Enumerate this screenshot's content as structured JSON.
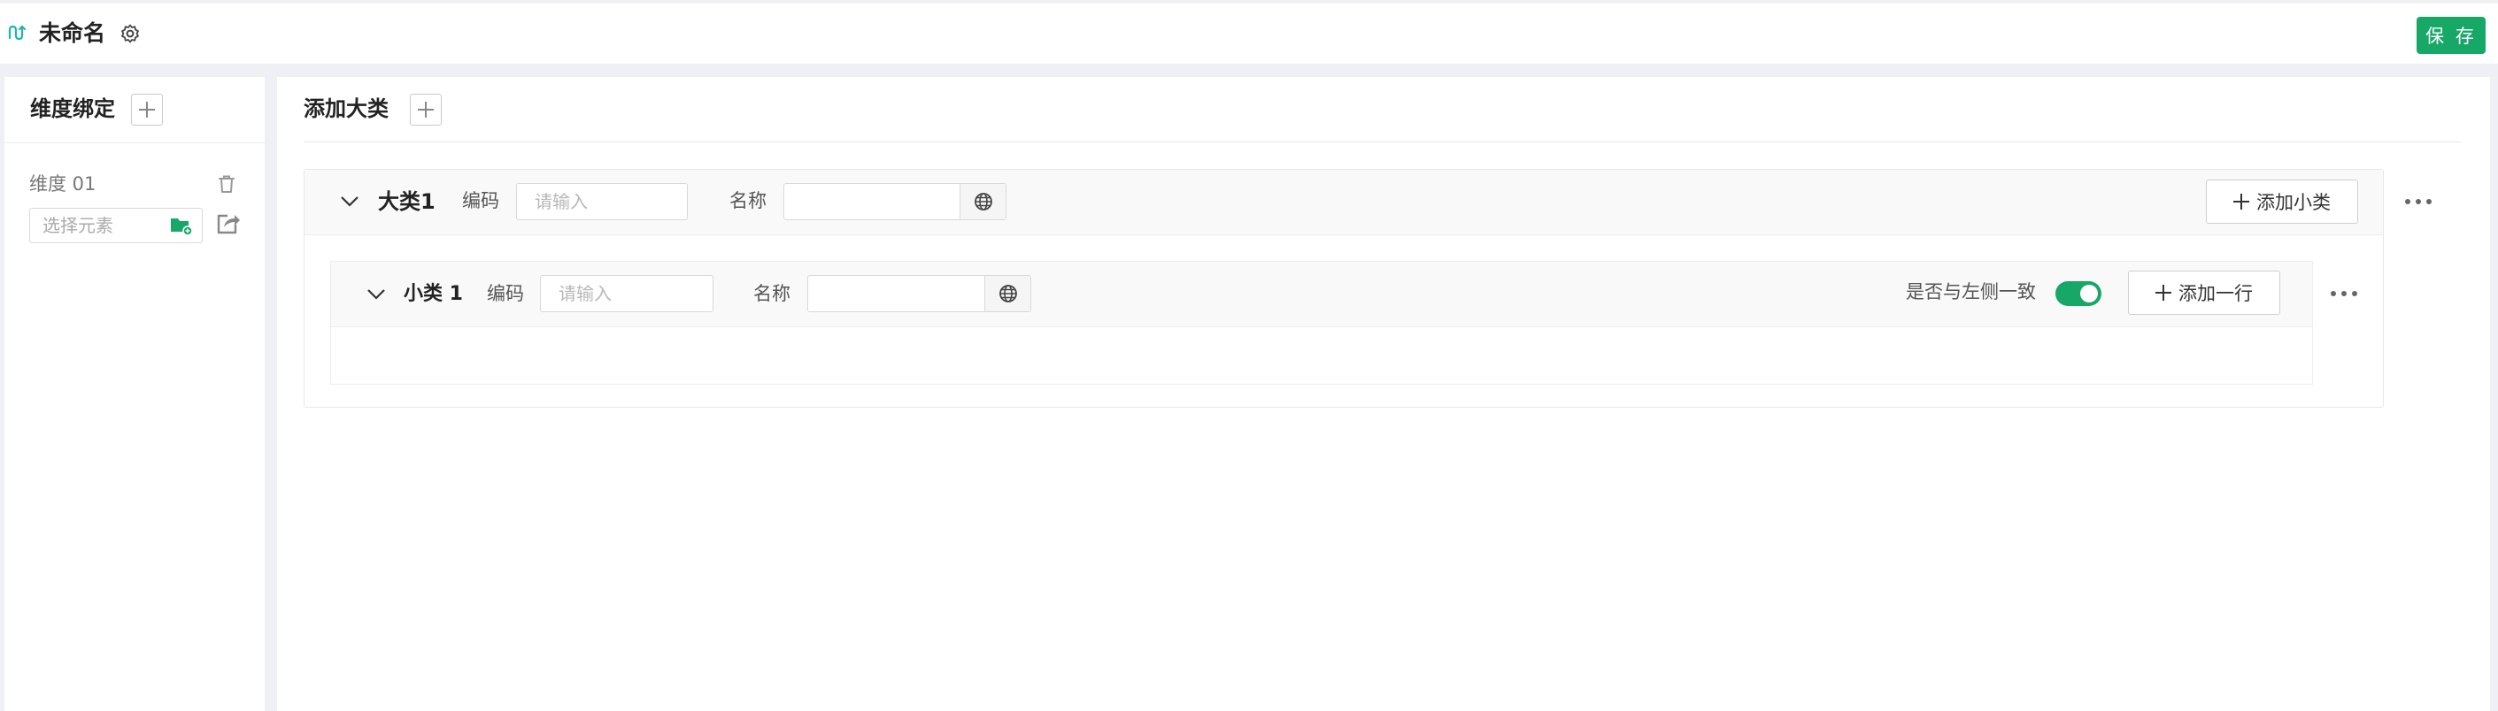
{
  "header": {
    "title": "未命名",
    "save_label": "保 存",
    "icons": [
      "flow-icon",
      "gear-icon"
    ]
  },
  "left_panel": {
    "title": "维度绑定",
    "dimension_label": "维度 01",
    "select_placeholder": "选择元素",
    "icons": [
      "trash-icon",
      "folder-icon",
      "share-icon"
    ]
  },
  "main": {
    "title": "添加大类",
    "category": {
      "name": "大类1",
      "code_label": "编码",
      "code_placeholder": "请输入",
      "name_label": "名称",
      "name_value": "",
      "add_sub_label": "添加小类"
    },
    "subcategory": {
      "name": "小类 1",
      "code_label": "编码",
      "code_placeholder": "请输入",
      "name_label": "名称",
      "name_value": "",
      "consistent_label": "是否与左侧一致",
      "consistent_on": true,
      "add_row_label": "添加一行"
    }
  },
  "colors": {
    "accent": "#17a868",
    "page_bg": "#eff0f5",
    "panel_bg": "#ffffff",
    "row_header_bg": "#f9f9f9"
  }
}
